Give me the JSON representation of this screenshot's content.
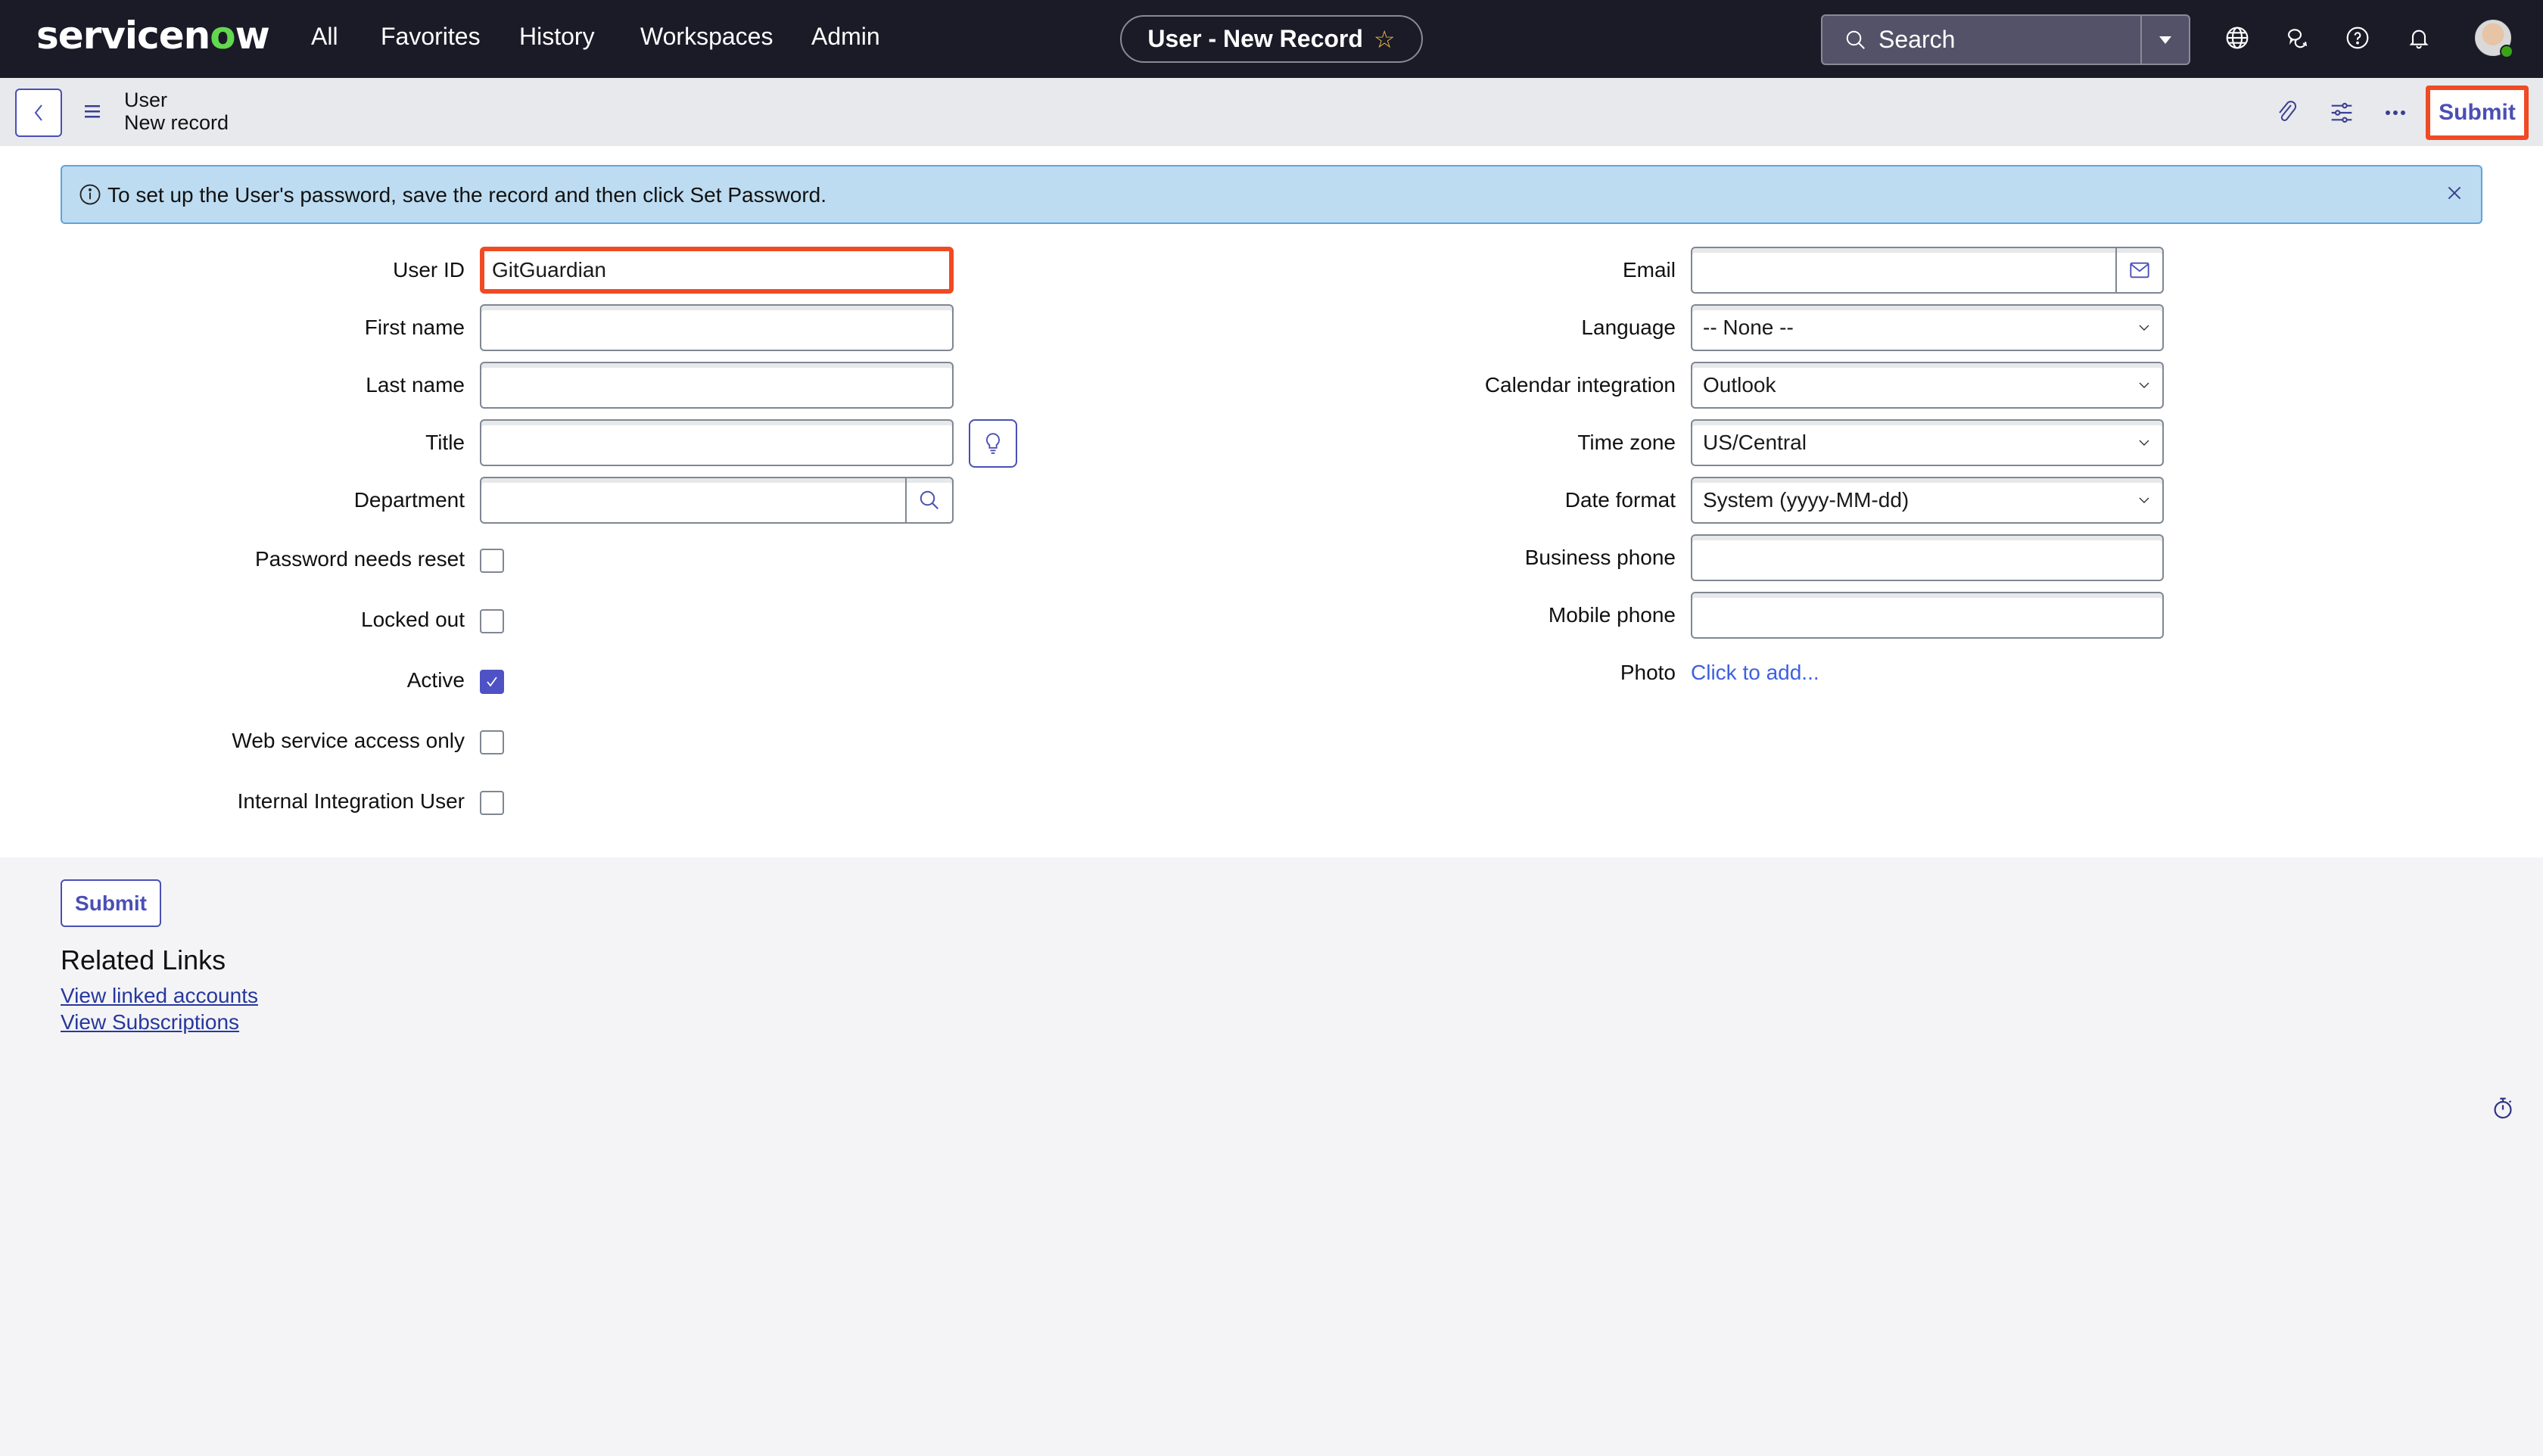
{
  "topnav": {
    "logo_text_pre": "servicen",
    "logo_text_o": "o",
    "logo_text_post": "w",
    "links": [
      "All",
      "Favorites",
      "History",
      "Workspaces",
      "Admin"
    ],
    "record_title": "User - New Record",
    "search_placeholder": "Search",
    "icons": [
      "globe-icon",
      "chat-icon",
      "help-icon",
      "bell-icon"
    ],
    "brand_color": "#62d84e"
  },
  "subheader": {
    "breadcrumb_table": "User",
    "breadcrumb_record": "New record",
    "submit_label": "Submit"
  },
  "banner": {
    "message": "To set up the User's password, save the record and then click Set Password."
  },
  "form": {
    "left": {
      "user_id": {
        "label": "User ID",
        "value": "GitGuardian"
      },
      "first_name": {
        "label": "First name",
        "value": ""
      },
      "last_name": {
        "label": "Last name",
        "value": ""
      },
      "title": {
        "label": "Title",
        "value": ""
      },
      "department": {
        "label": "Department",
        "value": ""
      },
      "checkboxes": [
        {
          "label": "Password needs reset",
          "checked": false
        },
        {
          "label": "Locked out",
          "checked": false
        },
        {
          "label": "Active",
          "checked": true
        },
        {
          "label": "Web service access only",
          "checked": false
        },
        {
          "label": "Internal Integration User",
          "checked": false
        }
      ]
    },
    "right": {
      "email": {
        "label": "Email",
        "value": ""
      },
      "language": {
        "label": "Language",
        "value": "-- None --"
      },
      "calendar_integration": {
        "label": "Calendar integration",
        "value": "Outlook"
      },
      "time_zone": {
        "label": "Time zone",
        "value": "US/Central"
      },
      "date_format": {
        "label": "Date format",
        "value": "System (yyyy-MM-dd)"
      },
      "business_phone": {
        "label": "Business phone",
        "value": ""
      },
      "mobile_phone": {
        "label": "Mobile phone",
        "value": ""
      },
      "photo": {
        "label": "Photo",
        "link": "Click to add..."
      }
    }
  },
  "footer": {
    "submit_label": "Submit",
    "related_links_title": "Related Links",
    "related_links": [
      "View linked accounts",
      "View Subscriptions"
    ]
  },
  "colors": {
    "accent": "#4a4fb4",
    "highlight": "#f04a24",
    "banner_bg": "#bddcf1",
    "nav_bg": "#1b1a27"
  }
}
